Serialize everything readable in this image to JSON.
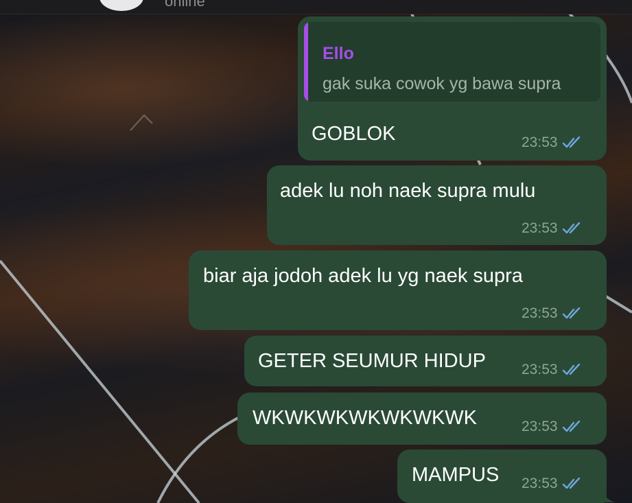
{
  "header": {
    "status": "online"
  },
  "messages": [
    {
      "reply": {
        "name": "Ello",
        "text": "gak suka cowok yg bawa supra"
      },
      "text": "GOBLOK",
      "time": "23:53",
      "status": "read"
    },
    {
      "text": "adek lu noh naek supra mulu",
      "time": "23:53",
      "status": "read"
    },
    {
      "text": "biar aja jodoh adek lu yg naek supra",
      "time": "23:53",
      "status": "read"
    },
    {
      "text": "GETER SEUMUR HIDUP",
      "time": "23:53",
      "status": "read"
    },
    {
      "text": "WKWKWKWKWKWKWK",
      "time": "23:53",
      "status": "read"
    },
    {
      "text": "MAMPUS",
      "time": "23:53",
      "status": "read"
    }
  ],
  "icons": {
    "read_receipt": "double-check-icon"
  },
  "colors": {
    "bubble": "#2a4a36",
    "reply_accent": "#a64ee9",
    "timestamp": "#8ea596",
    "tick": "#6fa8e0"
  }
}
